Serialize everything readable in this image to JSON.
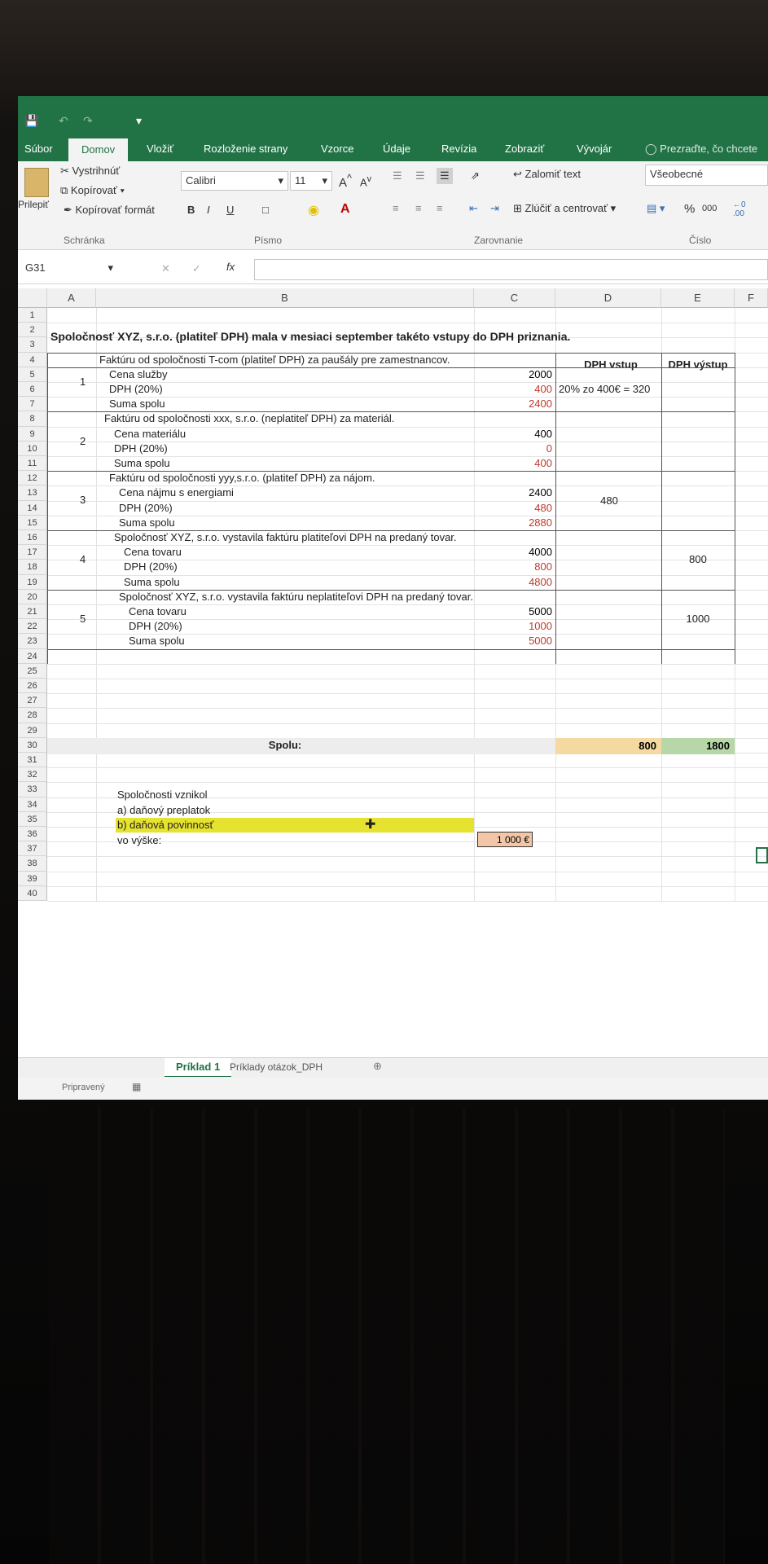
{
  "ribbon": {
    "tabs": [
      "Súbor",
      "Domov",
      "Vložiť",
      "Rozloženie strany",
      "Vzorce",
      "Údaje",
      "Revízia",
      "Zobraziť",
      "Vývojár",
      "Prezraďte, čo chcete"
    ],
    "clipboard": {
      "cut": "Vystrihnúť",
      "copy": "Kopírovať",
      "format_painter": "Kopírovať formát",
      "paste": "Prilepiť",
      "group": "Schránka"
    },
    "font": {
      "name": "Calibri",
      "size": "11",
      "group": "Písmo"
    },
    "alignment": {
      "wrap": "Zalomiť text",
      "merge": "Zlúčiť a centrovať",
      "group": "Zarovnanie"
    },
    "number": {
      "format": "Všeobecné",
      "group": "Číslo"
    }
  },
  "formula_bar": {
    "name_box": "G31",
    "fx": "fx"
  },
  "columns": [
    "A",
    "B",
    "C",
    "D",
    "E",
    "F"
  ],
  "rows": [
    "1",
    "2",
    "3",
    "4",
    "5",
    "6",
    "7",
    "8",
    "9",
    "10",
    "11",
    "12",
    "13",
    "14",
    "15",
    "16",
    "17",
    "18",
    "19",
    "20",
    "21",
    "22",
    "23",
    "24",
    "25",
    "26",
    "27",
    "28",
    "29",
    "30",
    "31",
    "32",
    "33",
    "34",
    "35",
    "36",
    "37",
    "38",
    "39",
    "40"
  ],
  "sheet": {
    "title": "Spoločnosť XYZ, s.r.o. (platiteľ DPH) mala v mesiaci september takéto vstupy do DPH priznania.",
    "hdr_vstup": "DPH vstup",
    "hdr_vystup": "DPH výstup",
    "blocks": [
      {
        "no": "1",
        "desc": "Faktúru od spoločnosti T-com (platiteľ DPH) za paušály pre zamestnancov.",
        "l1": "Cena služby",
        "v1": "2000",
        "l2": "DPH (20%)",
        "v2": "400",
        "l3": "Suma spolu",
        "v3": "2400",
        "vstup": "20% zo 400€ = 320",
        "vystup": ""
      },
      {
        "no": "2",
        "desc": "Faktúru od spoločnosti xxx, s.r.o. (neplatiteľ DPH) za materiál.",
        "l1": "Cena materiálu",
        "v1": "400",
        "l2": "DPH (20%)",
        "v2": "0",
        "l3": "Suma spolu",
        "v3": "400",
        "vstup": "",
        "vystup": ""
      },
      {
        "no": "3",
        "desc": "Faktúru od spoločnosti yyy,s.r.o. (platiteľ DPH) za nájom.",
        "l1": "Cena nájmu s energiami",
        "v1": "2400",
        "l2": "DPH (20%)",
        "v2": "480",
        "l3": "Suma spolu",
        "v3": "2880",
        "vstup": "480",
        "vystup": ""
      },
      {
        "no": "4",
        "desc": "Spoločnosť XYZ, s.r.o. vystavila faktúru platiteľovi DPH na predaný tovar.",
        "l1": "Cena tovaru",
        "v1": "4000",
        "l2": "DPH (20%)",
        "v2": "800",
        "l3": "Suma spolu",
        "v3": "4800",
        "vstup": "",
        "vystup": "800"
      },
      {
        "no": "5",
        "desc": "Spoločnosť XYZ, s.r.o. vystavila faktúru neplatiteľovi DPH na predaný tovar.",
        "l1": "Cena tovaru",
        "v1": "5000",
        "l2": "DPH (20%)",
        "v2": "1000",
        "l3": "Suma spolu",
        "v3": "5000",
        "vstup": "",
        "vystup": "1000"
      }
    ],
    "total_label": "Spolu:",
    "total_vstup": "800",
    "total_vystup": "1800",
    "q_label": "Spoločnosti vznikol",
    "q_a": "a) daňový preplatok",
    "q_b": "b) daňová povinnosť",
    "q_amount_label": "vo výške:",
    "q_amount": "1 000 €"
  },
  "sheet_tabs": [
    "Príklad 1",
    "Príklady otázok_DPH"
  ],
  "status": "Pripravený",
  "colors": {
    "excel_green": "#217346",
    "total_vstup_bg": "#f4d9a0",
    "total_vystup_bg": "#b7d7a8",
    "highlight": "#e6e230",
    "amount_bg": "#f2c6a6"
  }
}
